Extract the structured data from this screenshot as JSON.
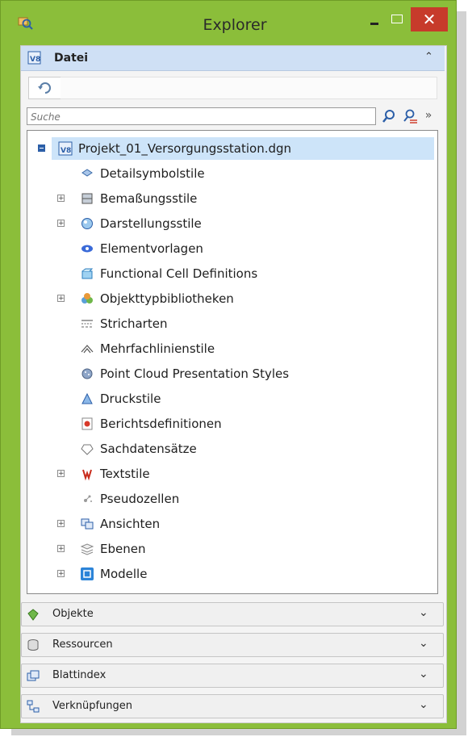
{
  "window": {
    "title": "Explorer",
    "close_glyph": "✕"
  },
  "panel": {
    "label": "Datei"
  },
  "search": {
    "placeholder": "Suche",
    "value": ""
  },
  "tree": {
    "root": "Projekt_01_Versorgungsstation.dgn",
    "items": [
      {
        "label": "Detailsymbolstile",
        "expandable": false,
        "icon": "detail-symbol-icon"
      },
      {
        "label": "Bemaßungsstile",
        "expandable": true,
        "icon": "dimension-style-icon"
      },
      {
        "label": "Darstellungsstile",
        "expandable": true,
        "icon": "display-style-icon"
      },
      {
        "label": "Elementvorlagen",
        "expandable": false,
        "icon": "element-template-icon"
      },
      {
        "label": "Functional Cell Definitions",
        "expandable": false,
        "icon": "functional-cell-icon"
      },
      {
        "label": "Objekttypbibliotheken",
        "expandable": true,
        "icon": "object-library-icon"
      },
      {
        "label": "Stricharten",
        "expandable": false,
        "icon": "line-style-icon"
      },
      {
        "label": "Mehrfachlinienstile",
        "expandable": false,
        "icon": "multiline-style-icon"
      },
      {
        "label": "Point Cloud Presentation Styles",
        "expandable": false,
        "icon": "point-cloud-icon"
      },
      {
        "label": "Druckstile",
        "expandable": false,
        "icon": "print-style-icon"
      },
      {
        "label": "Berichtsdefinitionen",
        "expandable": false,
        "icon": "report-icon"
      },
      {
        "label": "Sachdatensätze",
        "expandable": false,
        "icon": "item-type-icon"
      },
      {
        "label": "Textstile",
        "expandable": true,
        "icon": "text-style-icon"
      },
      {
        "label": "Pseudozellen",
        "expandable": false,
        "icon": "cell-icon"
      },
      {
        "label": "Ansichten",
        "expandable": true,
        "icon": "views-icon"
      },
      {
        "label": "Ebenen",
        "expandable": true,
        "icon": "levels-icon"
      },
      {
        "label": "Modelle",
        "expandable": true,
        "icon": "models-icon"
      }
    ]
  },
  "accordions": [
    {
      "label": "Objekte",
      "icon": "objects-icon"
    },
    {
      "label": "Ressourcen",
      "icon": "resources-icon"
    },
    {
      "label": "Blattindex",
      "icon": "sheet-index-icon"
    },
    {
      "label": "Verknüpfungen",
      "icon": "links-icon"
    }
  ],
  "colors": {
    "frame": "#8bbe3a",
    "header": "#cfe0f5",
    "selection": "#cde4f9",
    "close": "#c73b2b"
  }
}
